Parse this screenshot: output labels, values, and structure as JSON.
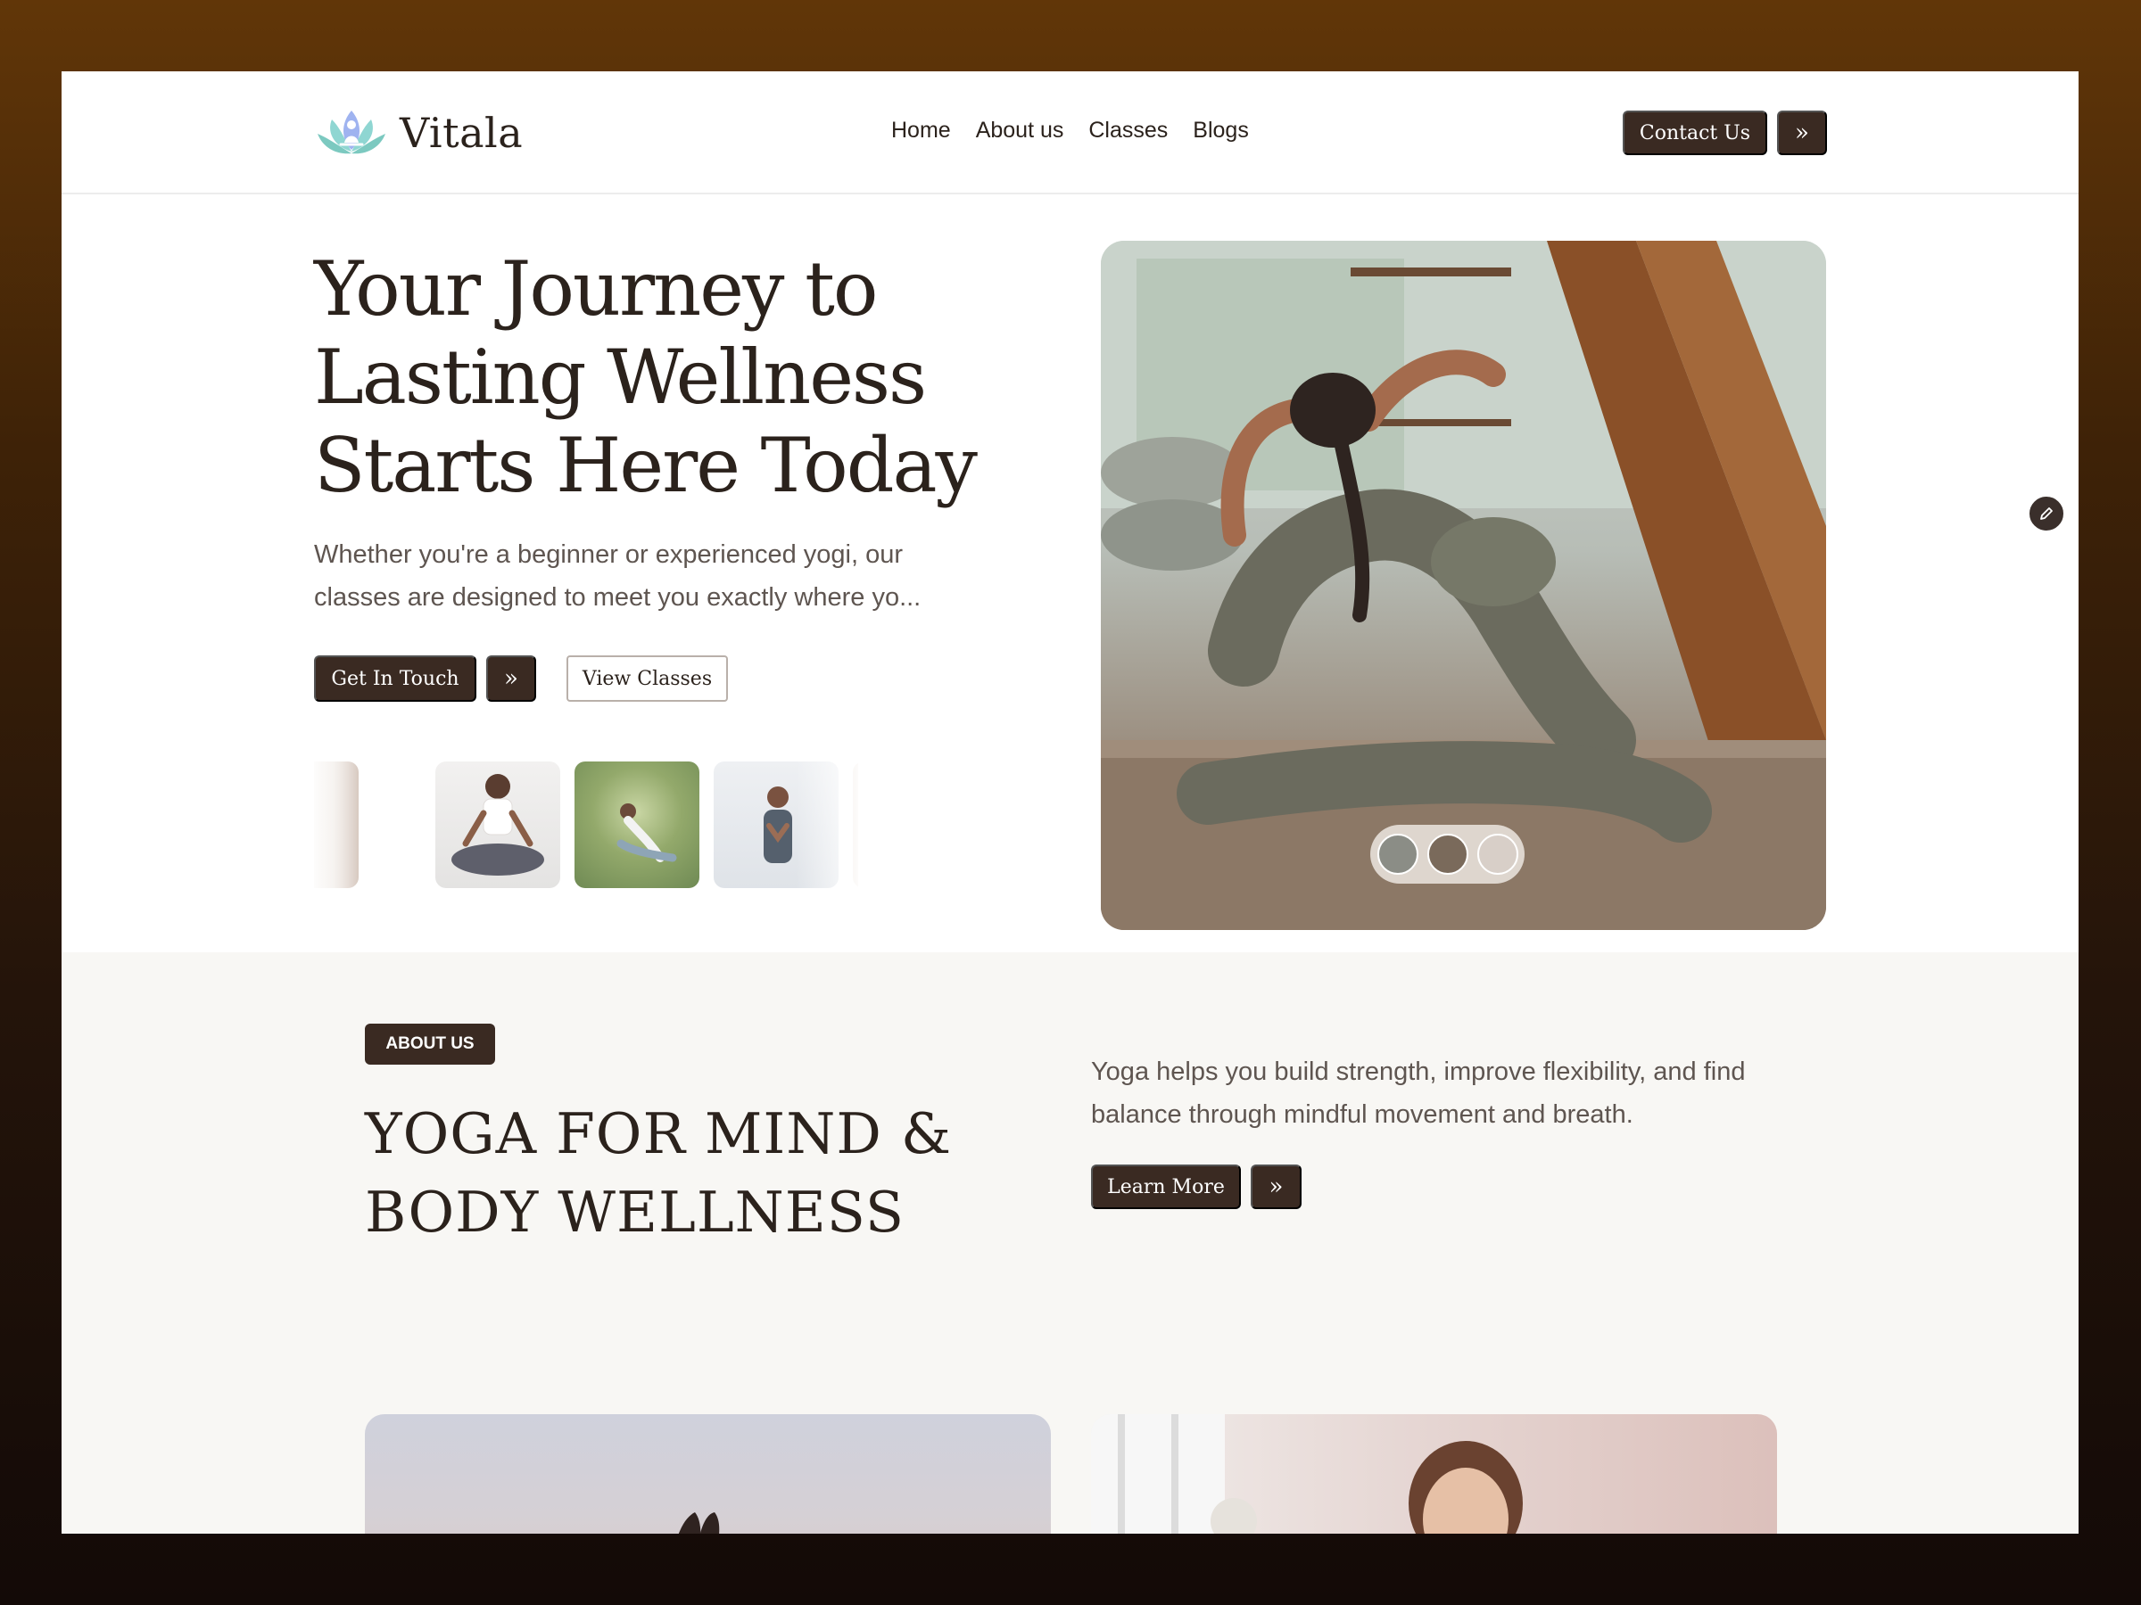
{
  "brand": {
    "name": "Vitala"
  },
  "nav": {
    "items": [
      {
        "label": "Home"
      },
      {
        "label": "About us"
      },
      {
        "label": "Classes"
      },
      {
        "label": "Blogs"
      }
    ],
    "contact_label": "Contact Us",
    "contact_arrow": "»"
  },
  "hero": {
    "title": "Your Journey to Lasting Wellness Starts Here Today",
    "subtitle": "Whether you're a beginner or experienced yogi, our\nclasses are designed to meet you exactly where yo...",
    "primary_cta": "Get In Touch",
    "primary_arrow": "»",
    "secondary_cta": "View Classes"
  },
  "about": {
    "badge": "ABOUT US",
    "title": "YOGA FOR MIND & BODY WELLNESS",
    "text": "Yoga helps you build strength, improve flexibility, and find\nbalance through mindful movement and breath.",
    "cta": "Learn More",
    "cta_arrow": "»"
  },
  "colors": {
    "accent_dark": "#3a2a22",
    "text_dark": "#2b221c",
    "text_muted": "#5e5550",
    "section_bg": "#f8f7f4",
    "frame_bg_top": "#613608",
    "frame_bg_bottom": "#130a07"
  }
}
